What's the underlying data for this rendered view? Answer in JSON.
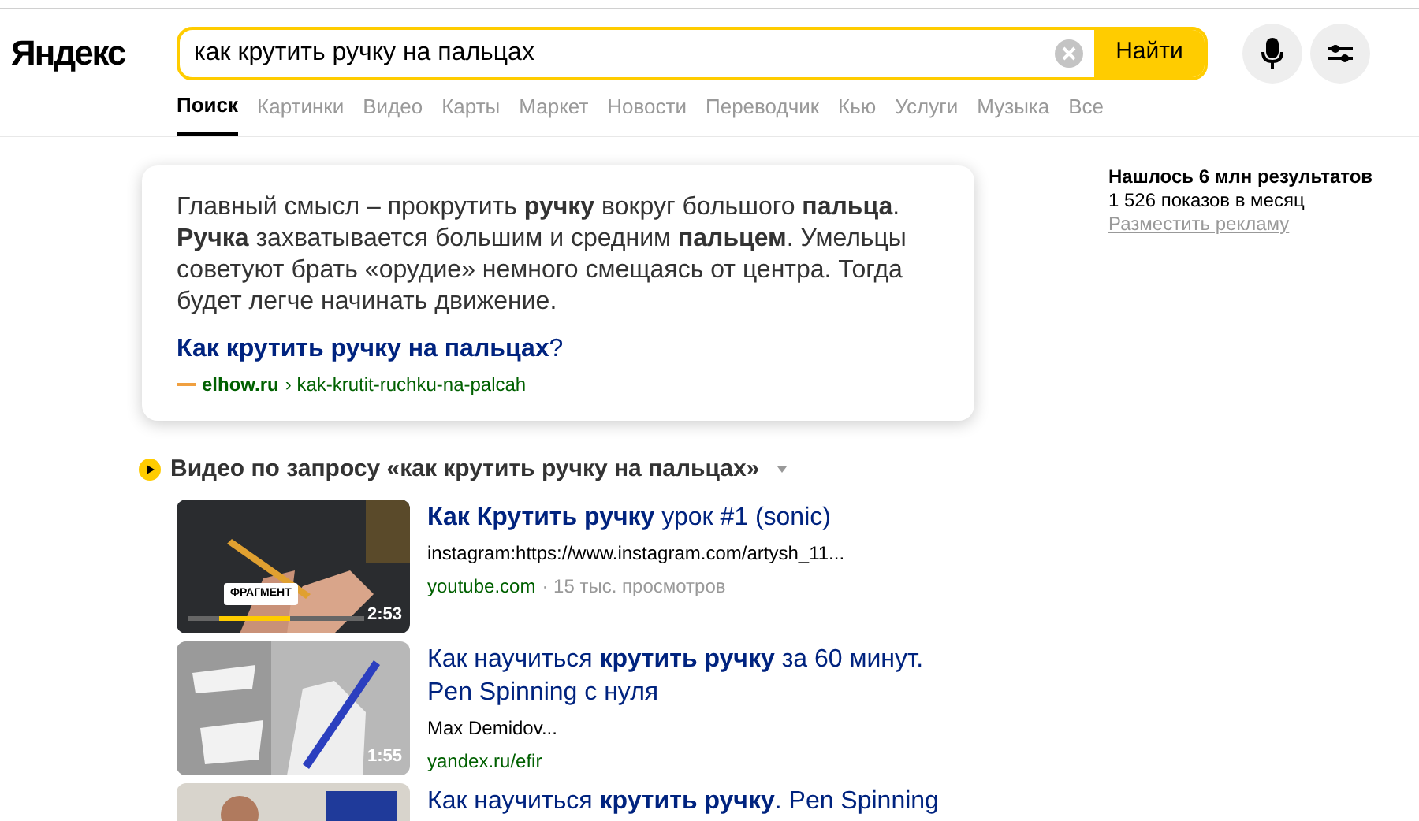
{
  "header": {
    "logo": "Яндекс",
    "search": {
      "value": "как крутить ручку на пальцах",
      "button": "Найти"
    }
  },
  "tabs": [
    {
      "label": "Поиск",
      "selected": true
    },
    {
      "label": "Картинки",
      "selected": false
    },
    {
      "label": "Видео",
      "selected": false
    },
    {
      "label": "Карты",
      "selected": false
    },
    {
      "label": "Маркет",
      "selected": false
    },
    {
      "label": "Новости",
      "selected": false
    },
    {
      "label": "Переводчик",
      "selected": false
    },
    {
      "label": "Кью",
      "selected": false
    },
    {
      "label": "Услуги",
      "selected": false
    },
    {
      "label": "Музыка",
      "selected": false
    },
    {
      "label": "Все",
      "selected": false
    }
  ],
  "answer": {
    "text": "Главный смысл – прокрутить **ручку** вокруг большого **пальца**. **Ручка** захватывается большим и средним **пальцем**. Умельцы советуют брать «орудие» немного смещаясь от центра. Тогда будет легче начинать движение.",
    "link": "**Как крутить ручку на пальцах**?",
    "site": "elhow.ru",
    "path": "› kak-krutit-ruchku-na-palcah"
  },
  "stats": {
    "found": "Нашлось 6 млн результатов",
    "shows": "1 526 показов в месяц",
    "advertise": "Разместить рекламу"
  },
  "videos": {
    "heading": "Видео по запросу «как крутить ручку на пальцах»",
    "items": [
      {
        "title": "**Как Крутить ручку** урок #1 (sonic)",
        "description": "instagram:https://www.instagram.com/artysh_11...",
        "source": "youtube.com",
        "views": "· 15 тыс. просмотров",
        "badge": "ФРАГМЕНТ",
        "duration": "2:53",
        "level": 0.4
      },
      {
        "title": "Как научиться **крутить ручку** за 60 минут. Pen Spinning с нуля",
        "description": "Max Demidov...",
        "source": "yandex.ru/efir",
        "duration": "1:55"
      },
      {
        "title": "Как научиться **крутить ручку**. Pen Spinning"
      }
    ]
  }
}
